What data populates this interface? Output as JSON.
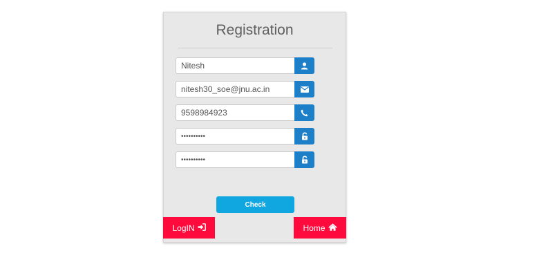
{
  "registration": {
    "title": "Registration",
    "fields": [
      {
        "value": "Nitesh",
        "type": "text",
        "icon": "user-icon"
      },
      {
        "value": "nitesh30_soe@jnu.ac.in",
        "type": "text",
        "icon": "envelope-icon"
      },
      {
        "value": "9598984923",
        "type": "text",
        "icon": "phone-icon"
      },
      {
        "value": "••••••••••",
        "type": "password",
        "icon": "unlock-icon"
      },
      {
        "value": "••••••••••",
        "type": "password",
        "icon": "unlock-icon"
      }
    ],
    "check_label": "Check",
    "login_label": "LogIN",
    "home_label": "Home"
  },
  "colors": {
    "card_bg": "#e8e8e8",
    "addon_blue": "#1c7fc7",
    "check_blue": "#10a6e0",
    "accent_red": "#ff0a3d"
  }
}
